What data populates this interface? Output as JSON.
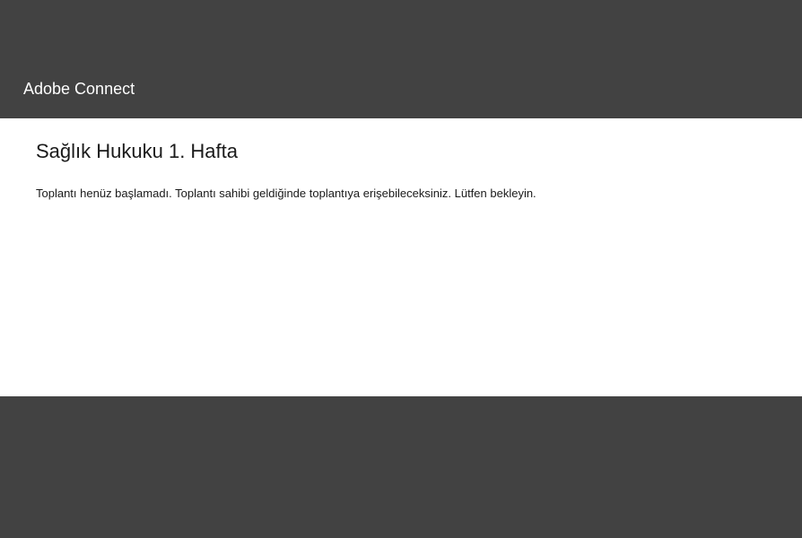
{
  "header": {
    "brand": "Adobe Connect"
  },
  "content": {
    "meeting_title": "Sağlık Hukuku 1. Hafta",
    "meeting_message": "Toplantı henüz başlamadı. Toplantı sahibi geldiğinde toplantıya erişebileceksiniz. Lütfen bekleyin."
  }
}
